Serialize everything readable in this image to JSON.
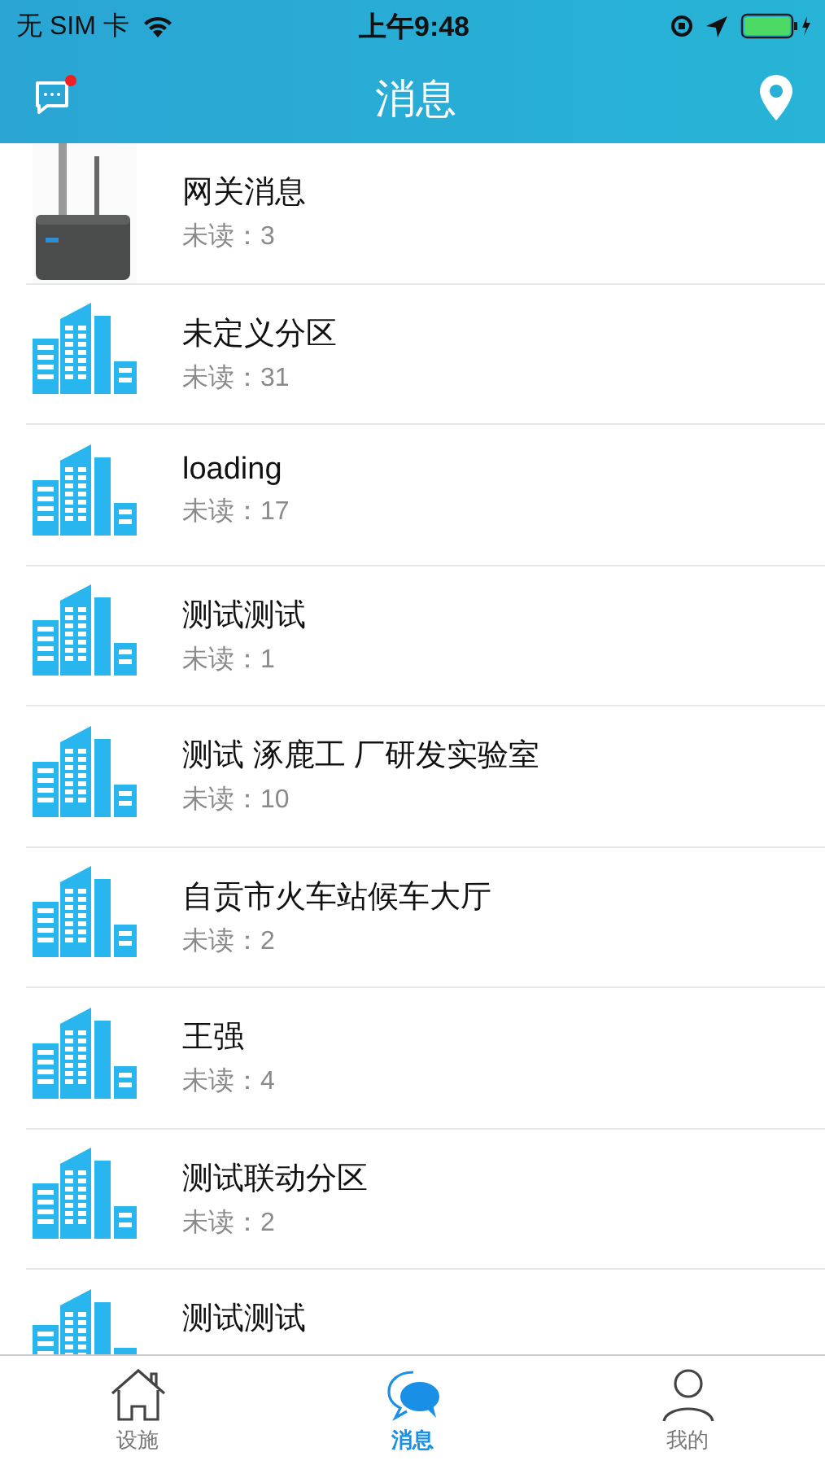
{
  "status_bar": {
    "carrier": "无 SIM 卡",
    "time": "上午9:48"
  },
  "nav": {
    "title": "消息",
    "has_unread_dot": true
  },
  "items": [
    {
      "kind": "gateway",
      "title": "网关消息",
      "unread": "未读：3"
    },
    {
      "kind": "building",
      "title": "未定义分区",
      "unread": "未读：31"
    },
    {
      "kind": "building",
      "title": "loading",
      "unread": "未读：17"
    },
    {
      "kind": "building",
      "title": "测试测试",
      "unread": "未读：1"
    },
    {
      "kind": "building",
      "title": "测试 涿鹿工 厂研发实验室",
      "unread": "未读：10"
    },
    {
      "kind": "building",
      "title": "自贡市火车站候车大厅",
      "unread": "未读：2"
    },
    {
      "kind": "building",
      "title": "王强",
      "unread": "未读：4"
    },
    {
      "kind": "building",
      "title": "测试联动分区",
      "unread": "未读：2"
    },
    {
      "kind": "building",
      "title": "测试测试"
    }
  ],
  "tabs": [
    {
      "kind": "home",
      "label": "设施",
      "selected": false
    },
    {
      "kind": "chat",
      "label": "消息",
      "selected": true
    },
    {
      "kind": "user",
      "label": "我的",
      "selected": false
    }
  ]
}
